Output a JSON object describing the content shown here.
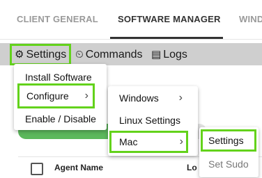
{
  "tabs": [
    "CLIENT GENERAL",
    "SOFTWARE MANAGER",
    "WIND"
  ],
  "toolbar": {
    "settings": "Settings",
    "commands": "Commands",
    "logs": "Logs",
    "settings_icon": "⚙",
    "commands_icon": "⏲",
    "logs_icon": "▤"
  },
  "menu1": {
    "install": "Install Software",
    "configure": "Configure",
    "enable_disable": "Enable / Disable"
  },
  "menu2": {
    "windows": "Windows",
    "linux": "Linux Settings",
    "mac": "Mac"
  },
  "menu3": {
    "settings": "Settings",
    "set_sudo": "Set Sudo"
  },
  "table": {
    "col_agent": "Agent Name",
    "col_last": "Lo"
  },
  "chevron": "›",
  "colors": {
    "highlight": "#63d21b",
    "toolbar_bg": "#cfcfcf",
    "pill": "#5cb85c"
  }
}
